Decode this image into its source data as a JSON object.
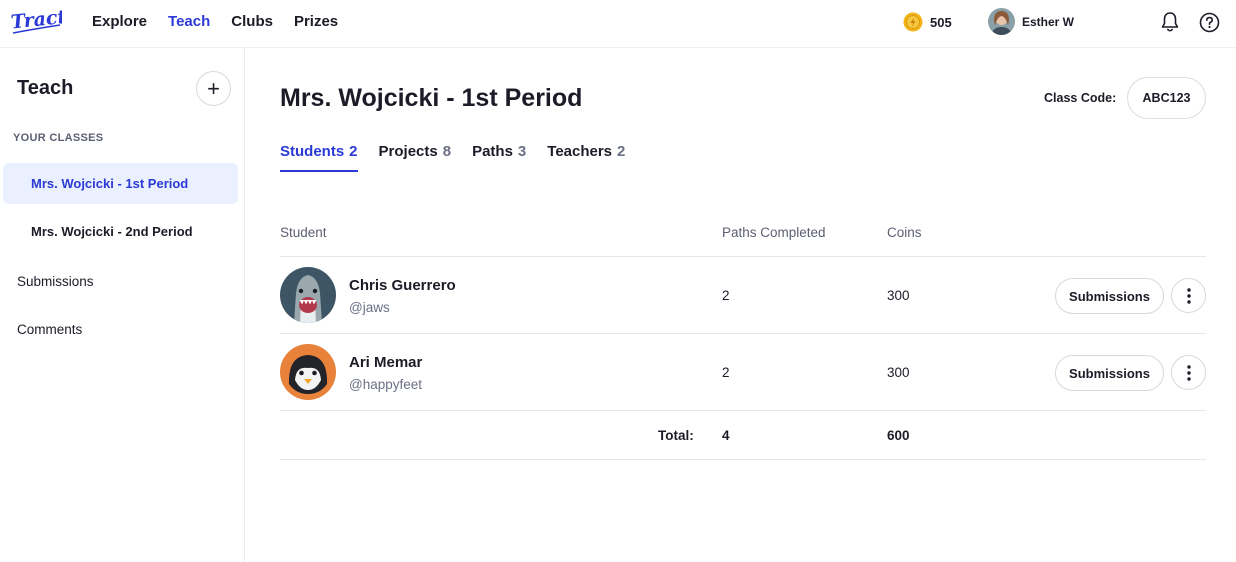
{
  "nav": {
    "logo_text": "Tract",
    "links": [
      "Explore",
      "Teach",
      "Clubs",
      "Prizes"
    ],
    "active": "Teach",
    "coins": "505",
    "user_name": "Esther W"
  },
  "sidebar": {
    "title": "Teach",
    "add_label": "+",
    "section_label": "YOUR CLASSES",
    "classes": [
      "Mrs. Wojcicki - 1st Period",
      "Mrs. Wojcicki - 2nd Period"
    ],
    "active_class": "Mrs. Wojcicki - 1st Period",
    "links": [
      "Submissions",
      "Comments"
    ]
  },
  "main": {
    "title": "Mrs. Wojcicki - 1st Period",
    "class_code_label": "Class Code:",
    "class_code": "ABC123",
    "tabs": [
      {
        "label": "Students",
        "count": "2"
      },
      {
        "label": "Projects",
        "count": "8"
      },
      {
        "label": "Paths",
        "count": "3"
      },
      {
        "label": "Teachers",
        "count": "2"
      }
    ],
    "active_tab": "Students",
    "table": {
      "headers": [
        "Student",
        "Paths Completed",
        "Coins"
      ],
      "rows": [
        {
          "name": "Chris Guerrero",
          "handle": "@jaws",
          "paths": "2",
          "coins": "300",
          "action": "Submissions"
        },
        {
          "name": "Ari Memar",
          "handle": "@happyfeet",
          "paths": "2",
          "coins": "300",
          "action": "Submissions"
        }
      ],
      "total_label": "Total:",
      "total_paths": "4",
      "total_coins": "600"
    }
  },
  "colors": {
    "accent": "#2b3ad6",
    "active_bg": "#eaf0ff",
    "shark_bg": "#3e5566",
    "penguin_bg": "#e8823a",
    "coin": "#f2b418"
  },
  "icons": {
    "coin": "coin-icon",
    "bell": "bell-icon",
    "help": "help-icon",
    "more": "more-vertical-icon",
    "add": "plus-icon"
  }
}
